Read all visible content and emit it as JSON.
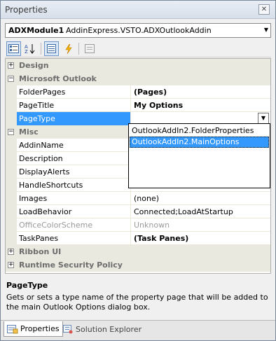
{
  "window": {
    "title": "Properties",
    "close_glyph": "✕"
  },
  "object_selector": {
    "name": "ADXModule1",
    "type": "AddinExpress.VSTO.ADXOutlookAddin",
    "arrow": "▼"
  },
  "toolbar": {
    "categorized_icon": "categorized-icon",
    "alphabetical_icon": "alphabetical-icon",
    "properties_icon": "properties-icon",
    "events_icon": "events-icon",
    "property_pages_icon": "property-pages-icon"
  },
  "grid": {
    "categories": {
      "design": {
        "label": "Design",
        "expander": "+"
      },
      "microsoft_outlook": {
        "label": "Microsoft Outlook",
        "expander": "−"
      },
      "misc": {
        "label": "Misc",
        "expander": "−"
      },
      "ribbon_ui": {
        "label": "Ribbon UI",
        "expander": "+"
      },
      "runtime_security": {
        "label": "Runtime Security Policy",
        "expander": "+"
      }
    },
    "rows": {
      "folder_pages": {
        "name": "FolderPages",
        "value": "(Pages)"
      },
      "page_title": {
        "name": "PageTitle",
        "value": "My Options"
      },
      "page_type": {
        "name": "PageType",
        "value": ""
      },
      "addin_name": {
        "name": "AddinName"
      },
      "description": {
        "name": "Description"
      },
      "display_alerts": {
        "name": "DisplayAlerts"
      },
      "handle_shortcuts": {
        "name": "HandleShortcuts"
      },
      "images": {
        "name": "Images",
        "value": "(none)"
      },
      "load_behavior": {
        "name": "LoadBehavior",
        "value": "Connected;LoadAtStartup"
      },
      "office_color_scheme": {
        "name": "OfficeColorScheme",
        "value": "Unknown"
      },
      "task_panes": {
        "name": "TaskPanes",
        "value": "(Task Panes)"
      }
    },
    "dropdown_arrow": "▼",
    "dropdown_options": [
      "OutlookAddIn2.FolderProperties",
      "OutlookAddIn2.MainOptions"
    ],
    "dropdown_selected": "OutlookAddIn2.MainOptions"
  },
  "description_panel": {
    "title": "PageType",
    "text": "Gets or sets a type name of the property page that will be added to the main Outlook Options dialog box."
  },
  "tabs": [
    {
      "label": "Properties",
      "icon": "properties-tab-icon",
      "active": true
    },
    {
      "label": "Solution Explorer",
      "icon": "solution-explorer-icon",
      "active": false
    }
  ],
  "colors": {
    "selection": "#3399ff",
    "category_bg": "#e9e9e0"
  }
}
